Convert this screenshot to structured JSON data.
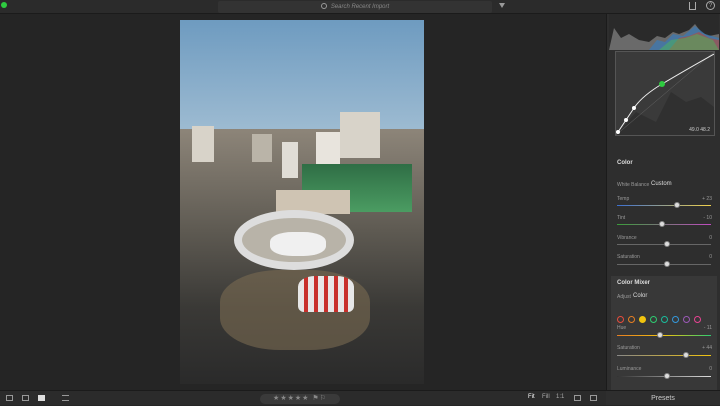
{
  "topbar": {
    "search_placeholder": "Search Recent Import"
  },
  "curve": {
    "readout": "49.0  48.2"
  },
  "color_section": {
    "title": "Color",
    "white_balance_label": "White Balance",
    "white_balance_value": "Custom",
    "temp_label": "Temp",
    "temp_value": "+ 23",
    "tint_label": "Tint",
    "tint_value": "- 10",
    "vibrance_label": "Vibrance",
    "vibrance_value": "0",
    "saturation_label": "Saturation",
    "saturation_value": "0"
  },
  "mixer": {
    "title": "Color Mixer",
    "adjust_label": "Adjust",
    "adjust_value": "Color",
    "hue_label": "Hue",
    "hue_value": "- 11",
    "saturation_label": "Saturation",
    "saturation_value": "+ 44",
    "luminance_label": "Luminance",
    "luminance_value": "0",
    "swatch_colors": [
      "#e74c3c",
      "#e67e22",
      "#f1c40f",
      "#2ecc71",
      "#1abc9c",
      "#3498db",
      "#9b59b6",
      "#e84393"
    ]
  },
  "bottombar": {
    "stars": "★★★★★",
    "zoom_fit": "Fit",
    "zoom_fill": "Fill",
    "zoom_1to1": "1:1"
  },
  "presets_label": "Presets",
  "colors": {
    "selected_swatch": "#f1c40f",
    "curve_point": "#2ecc40"
  }
}
